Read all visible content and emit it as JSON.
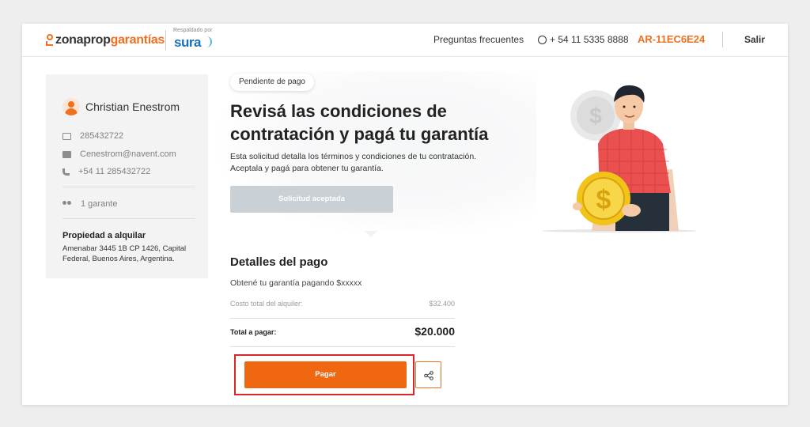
{
  "header": {
    "brand_a": "zonaprop",
    "brand_b": "garantías",
    "partner_caption": "Respaldado por",
    "partner": "sura",
    "faq": "Preguntas frecuentes",
    "phone": "+ 54 11 5335 8888",
    "code": "AR-11EC6E24",
    "logout": "Salir"
  },
  "sidebar": {
    "name": "Christian Enestrom",
    "document": "285432722",
    "email": "Cenestrom@navent.com",
    "phone": "+54 11 285432722",
    "guarantors": "1 garante",
    "property_title": "Propiedad a alquilar",
    "property_address": "Amenabar 3445 1B CP 1426, Capital Federal, Buenos Aires, Argentina."
  },
  "main": {
    "badge": "Pendiente de pago",
    "title": "Revisá las condiciones de contratación y pagá tu garantía",
    "description": "Esta solicitud detalla los términos y condiciones de tu contratación. Aceptala y pagá para obtener tu garantía.",
    "accepted_button": "Solicitud aceptada"
  },
  "payment": {
    "title": "Detalles del pago",
    "subtitle": "Obtené tu garantía pagando $xxxxx",
    "cost_label": "Costo total del alquiler:",
    "cost_value": "$32.400",
    "total_label": "Total a pagar:",
    "total_value": "$20.000",
    "pay_button": "Pagar"
  },
  "icons": {
    "share": "share-icon",
    "whatsapp": "whatsapp-icon"
  },
  "colors": {
    "accent": "#f06712",
    "highlight": "#d8262b",
    "disabled": "#c9d0d6",
    "partner": "#1a6fb5"
  }
}
